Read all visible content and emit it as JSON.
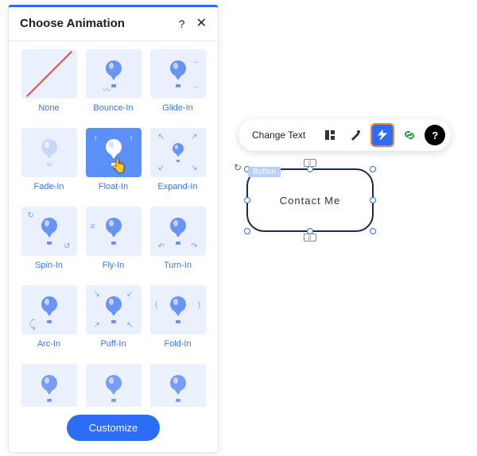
{
  "panel": {
    "title": "Choose Animation",
    "customize_label": "Customize",
    "animations": [
      {
        "label": "None",
        "selected": false
      },
      {
        "label": "Bounce-In",
        "selected": false
      },
      {
        "label": "Glide-In",
        "selected": false
      },
      {
        "label": "Fade-In",
        "selected": false
      },
      {
        "label": "Float-In",
        "selected": true
      },
      {
        "label": "Expand-In",
        "selected": false
      },
      {
        "label": "Spin-In",
        "selected": false
      },
      {
        "label": "Fly-In",
        "selected": false
      },
      {
        "label": "Turn-In",
        "selected": false
      },
      {
        "label": "Arc-In",
        "selected": false
      },
      {
        "label": "Puff-In",
        "selected": false
      },
      {
        "label": "Fold-In",
        "selected": false
      }
    ]
  },
  "toolbar": {
    "change_text_label": "Change Text"
  },
  "element": {
    "tag": "Button",
    "text": "Contact Me"
  }
}
